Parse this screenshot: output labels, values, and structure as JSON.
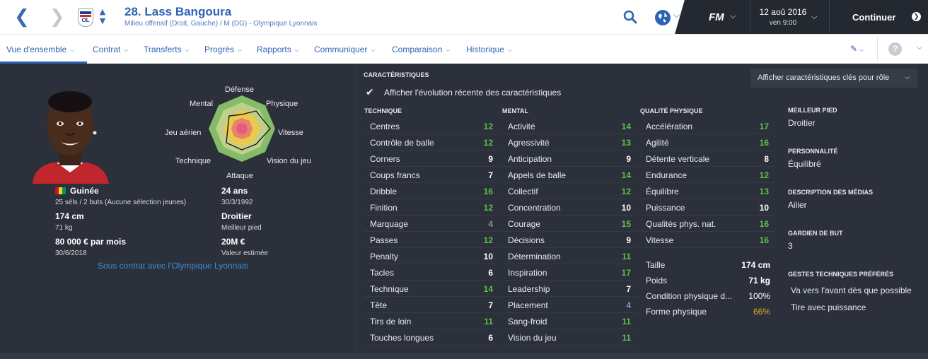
{
  "header": {
    "player_name": "28. Lass Bangoura",
    "player_sub": "Milieu offensif (Droit, Gauche) / M (DG) - Olympique Lyonnais",
    "crest_text": "OL",
    "fm_logo": "FM",
    "date": "12 aoû 2016",
    "time": "ven 9:00",
    "continue_label": "Continuer"
  },
  "tabs": [
    {
      "label": "Vue d'ensemble"
    },
    {
      "label": "Contrat"
    },
    {
      "label": "Transferts"
    },
    {
      "label": "Progrès"
    },
    {
      "label": "Rapports"
    },
    {
      "label": "Communiquer"
    },
    {
      "label": "Comparaison"
    },
    {
      "label": "Historique"
    }
  ],
  "profile": {
    "nationality": "Guinée",
    "caps": "25 séls / 2 buts (Aucune sélection jeunes)",
    "height": "174 cm",
    "weight": "71 kg",
    "wage": "80 000 € par mois",
    "contract_end": "30/6/2018",
    "age": "24 ans",
    "birthdate": "30/3/1992",
    "foot": "Droitier",
    "foot_label": "Meilleur pied",
    "value": "20M €",
    "value_label": "Valeur estimée",
    "contract_text": "Sous contrat avec l'Olympique Lyonnais",
    "flag_colors": [
      "#ce1126",
      "#fcd116",
      "#009460"
    ]
  },
  "radar": {
    "labels": [
      "Défense",
      "Physique",
      "Vitesse",
      "Vision du jeu",
      "Attaque",
      "Technique",
      "Jeu aérien",
      "Mental"
    ]
  },
  "attributes": {
    "section_title": "CARACTÉRISTIQUES",
    "role_button": "Afficher caractéristiques clés pour rôle",
    "show_evolution": "Afficher l'évolution récente des caractéristiques",
    "technique_title": "TECHNIQUE",
    "mental_title": "MENTAL",
    "physical_title": "QUALITÉ PHYSIQUE",
    "technique": [
      {
        "name": "Centres",
        "value": "12"
      },
      {
        "name": "Contrôle de balle",
        "value": "12"
      },
      {
        "name": "Corners",
        "value": "9"
      },
      {
        "name": "Coups francs",
        "value": "7"
      },
      {
        "name": "Dribble",
        "value": "16"
      },
      {
        "name": "Finition",
        "value": "12"
      },
      {
        "name": "Marquage",
        "value": "4"
      },
      {
        "name": "Passes",
        "value": "12"
      },
      {
        "name": "Penalty",
        "value": "10"
      },
      {
        "name": "Tacles",
        "value": "6"
      },
      {
        "name": "Technique",
        "value": "14"
      },
      {
        "name": "Tête",
        "value": "7"
      },
      {
        "name": "Tirs de loin",
        "value": "11"
      },
      {
        "name": "Touches longues",
        "value": "6"
      }
    ],
    "mental": [
      {
        "name": "Activité",
        "value": "14"
      },
      {
        "name": "Agressivité",
        "value": "13"
      },
      {
        "name": "Anticipation",
        "value": "9"
      },
      {
        "name": "Appels de balle",
        "value": "14"
      },
      {
        "name": "Collectif",
        "value": "12"
      },
      {
        "name": "Concentration",
        "value": "10"
      },
      {
        "name": "Courage",
        "value": "15"
      },
      {
        "name": "Décisions",
        "value": "9"
      },
      {
        "name": "Détermination",
        "value": "11"
      },
      {
        "name": "Inspiration",
        "value": "17"
      },
      {
        "name": "Leadership",
        "value": "7"
      },
      {
        "name": "Placement",
        "value": "4"
      },
      {
        "name": "Sang-froid",
        "value": "11"
      },
      {
        "name": "Vision du jeu",
        "value": "11"
      }
    ],
    "physical": [
      {
        "name": "Accélération",
        "value": "17"
      },
      {
        "name": "Agilité",
        "value": "16"
      },
      {
        "name": "Détente verticale",
        "value": "8"
      },
      {
        "name": "Endurance",
        "value": "12"
      },
      {
        "name": "Équilibre",
        "value": "13"
      },
      {
        "name": "Puissance",
        "value": "10"
      },
      {
        "name": "Qualités phys. nat.",
        "value": "16"
      },
      {
        "name": "Vitesse",
        "value": "16"
      }
    ],
    "physical_extra": [
      {
        "name": "Taille",
        "value": "174 cm"
      },
      {
        "name": "Poids",
        "value": "71 kg"
      },
      {
        "name": "Condition physique d...",
        "value": "100%"
      },
      {
        "name": "Forme physique",
        "value": "66%"
      }
    ]
  },
  "right_panel": {
    "best_foot_title": "MEILLEUR PIED",
    "best_foot": "Droitier",
    "personality_title": "PERSONNALITÉ",
    "personality": "Équilibré",
    "media_title": "DESCRIPTION DES MÉDIAS",
    "media": "Ailier",
    "gk_title": "GARDIEN DE BUT",
    "gk": "3",
    "ppm_title": "GESTES TECHNIQUES PRÉFÉRÉS",
    "ppms": [
      "Va vers l'avant dès que possible",
      "Tire avec puissance"
    ]
  },
  "colors": {
    "accent": "#2e63b4",
    "good": "#5fc14a",
    "poor": "#8f949c",
    "warning": "#e2a22f",
    "panel": "#2b303a"
  }
}
